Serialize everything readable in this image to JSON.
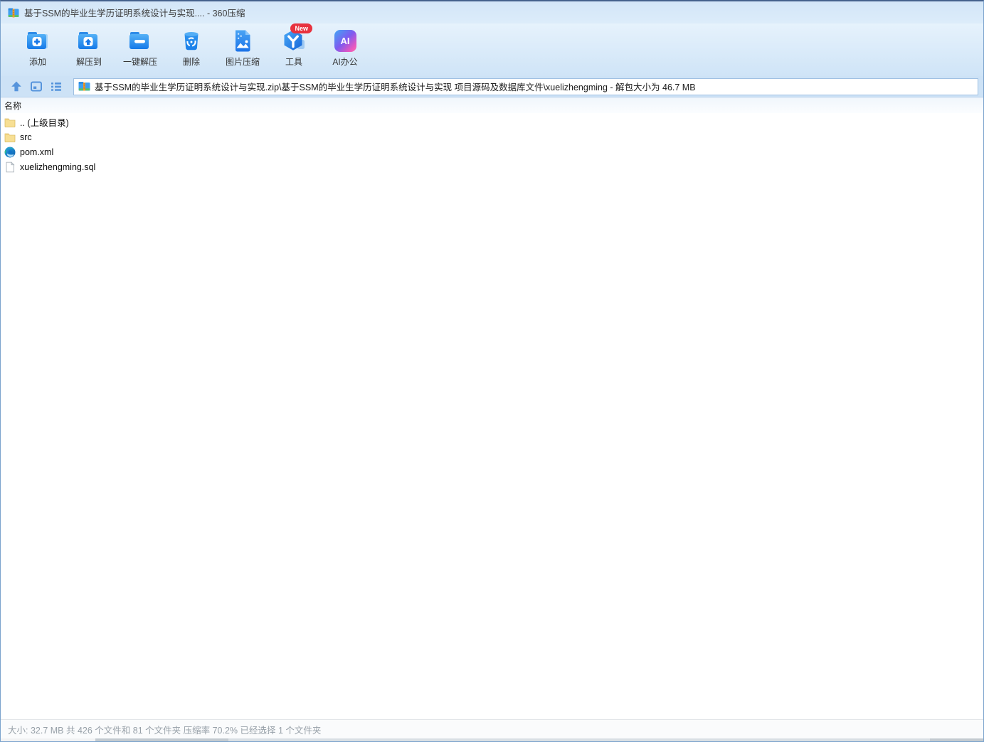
{
  "window": {
    "title": "基于SSM的毕业生学历证明系统设计与实现.... - 360压缩",
    "app_icon": "zip-archive-icon"
  },
  "toolbar": {
    "buttons": [
      {
        "label": "添加",
        "icon": "add-archive-icon"
      },
      {
        "label": "解压到",
        "icon": "extract-to-icon"
      },
      {
        "label": "一键解压",
        "icon": "one-click-extract-icon"
      },
      {
        "label": "删除",
        "icon": "delete-icon"
      },
      {
        "label": "图片压缩",
        "icon": "image-compress-icon"
      },
      {
        "label": "工具",
        "icon": "tools-icon",
        "badge": "New"
      },
      {
        "label": "AI办公",
        "icon": "ai-office-icon",
        "icon_text": "AI"
      }
    ]
  },
  "address_bar": {
    "nav_icons": [
      "up-icon",
      "preview-pane-icon",
      "list-view-icon"
    ],
    "path": "基于SSM的毕业生学历证明系统设计与实现.zip\\基于SSM的毕业生学历证明系统设计与实现 项目源码及数据库文件\\xuelizhengming - 解包大小为 46.7 MB"
  },
  "file_list": {
    "name_header": "名称",
    "items": [
      {
        "name": ".. (上级目录)",
        "icon": "folder-icon"
      },
      {
        "name": "src",
        "icon": "folder-icon"
      },
      {
        "name": "pom.xml",
        "icon": "edge-browser-icon"
      },
      {
        "name": "xuelizhengming.sql",
        "icon": "sql-file-icon"
      }
    ]
  },
  "status_bar": {
    "text": "大小: 32.7 MB 共 426 个文件和 81 个文件夹 压缩率 70.2% 已经选择 1 个文件夹"
  },
  "colors": {
    "chrome_blue_light": "#e6f2fc",
    "chrome_blue": "#cde2f6",
    "accent_blue": "#1f7ce8",
    "nav_icon_blue": "#5694dc",
    "badge_red": "#e8323f",
    "status_text": "#97a0a8"
  }
}
